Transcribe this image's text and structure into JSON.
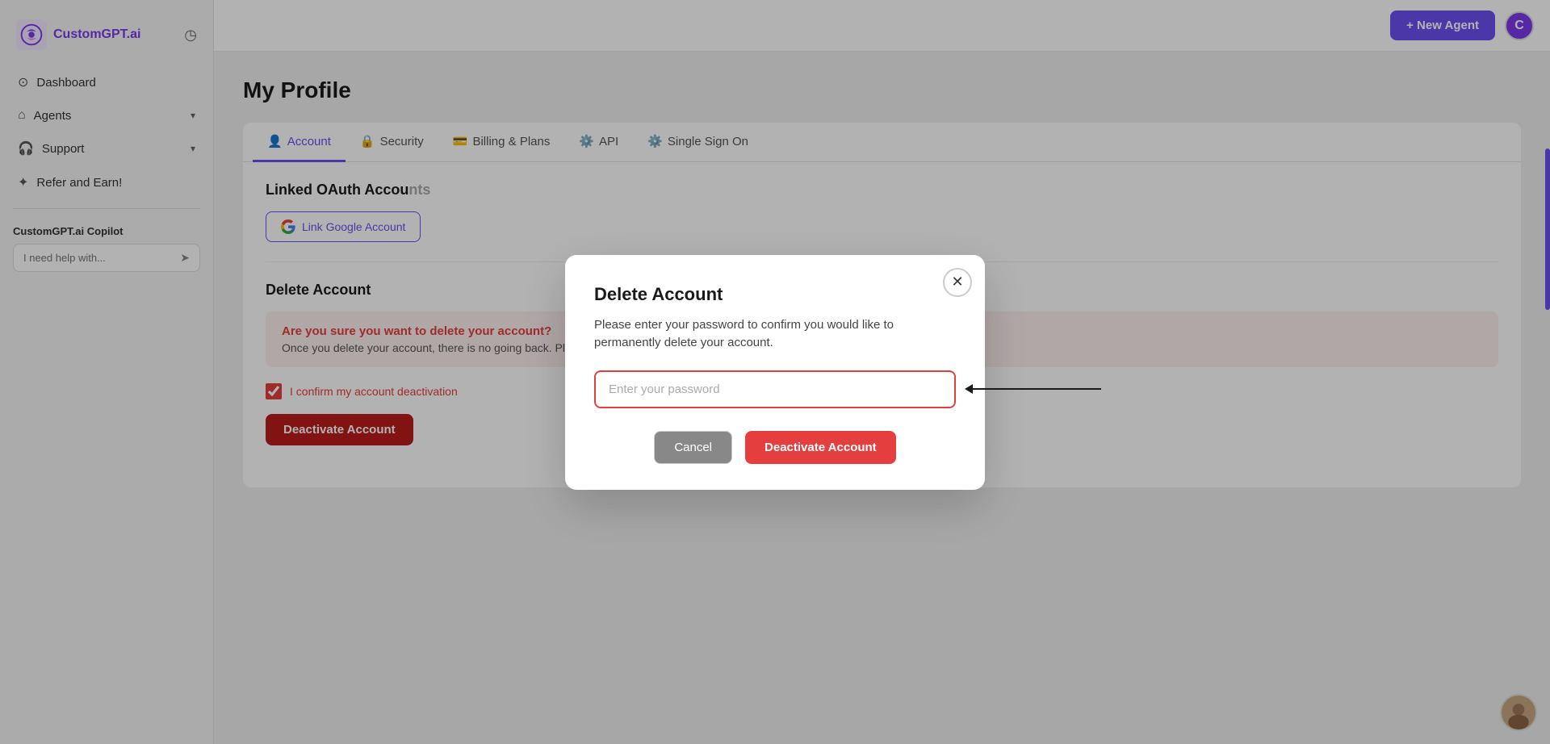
{
  "sidebar": {
    "logo_text": "CustomGPT.ai",
    "nav_items": [
      {
        "label": "Dashboard",
        "icon": "⊙"
      },
      {
        "label": "Agents",
        "icon": "⌂",
        "has_chevron": true
      },
      {
        "label": "Support",
        "icon": "🎧",
        "has_chevron": true
      },
      {
        "label": "Refer and Earn!",
        "icon": "✦"
      }
    ],
    "copilot": {
      "title": "CustomGPT.ai Copilot",
      "input_placeholder": "I need help with..."
    }
  },
  "topbar": {
    "new_agent_label": "+ New Agent",
    "user_initial": "C"
  },
  "page": {
    "title": "My Profile",
    "tabs": [
      {
        "label": "Account",
        "icon": "👤",
        "active": true
      },
      {
        "label": "Security",
        "icon": "🔒"
      },
      {
        "label": "Billing & Plans",
        "icon": "💳"
      },
      {
        "label": "API",
        "icon": "⚙️"
      },
      {
        "label": "Single Sign On",
        "icon": "⚙️"
      }
    ]
  },
  "linked_oauth": {
    "section_title": "Linked OAuth Accou",
    "google_btn_label": "Link Google Account"
  },
  "delete_account": {
    "section_title": "Delete Account",
    "warning_title": "Are you sure you want to delete your account?",
    "warning_text": "Once you delete your account, there is no going back. Please be certain.",
    "confirm_label": "I confirm my account deactivation",
    "deactivate_btn_label": "Deactivate Account"
  },
  "modal": {
    "title": "Delete Account",
    "description": "Please enter your password to confirm you would like to permanently delete your account.",
    "password_placeholder": "Enter your password",
    "cancel_label": "Cancel",
    "deactivate_label": "Deactivate Account",
    "close_icon": "✕"
  }
}
